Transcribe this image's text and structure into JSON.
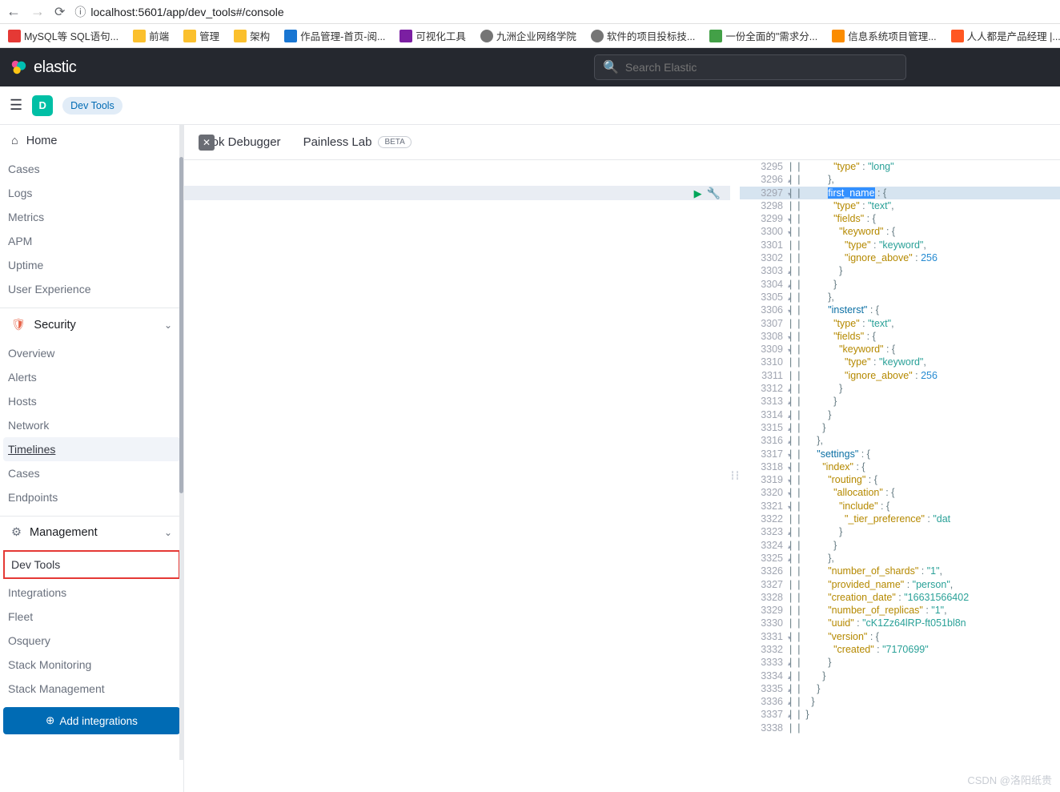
{
  "browser": {
    "url": "localhost:5601/app/dev_tools#/console"
  },
  "bookmarks": [
    {
      "icon": "red",
      "label": "MySQL等 SQL语句..."
    },
    {
      "icon": "yellow",
      "label": "前端"
    },
    {
      "icon": "yellow",
      "label": "管理"
    },
    {
      "icon": "yellow",
      "label": "架构"
    },
    {
      "icon": "blue",
      "label": "作品管理-首页-阅..."
    },
    {
      "icon": "purple",
      "label": "可视化工具"
    },
    {
      "icon": "gray",
      "label": "九洲企业网络学院"
    },
    {
      "icon": "gray",
      "label": "软件的项目投标技..."
    },
    {
      "icon": "green",
      "label": "一份全面的\"需求分..."
    },
    {
      "icon": "orange",
      "label": "信息系统项目管理..."
    },
    {
      "icon": "pink",
      "label": "人人都是产品经理 |..."
    }
  ],
  "header": {
    "brand": "elastic",
    "search_placeholder": "Search Elastic"
  },
  "subheader": {
    "avatar_letter": "D",
    "badge": "Dev Tools"
  },
  "tabs": {
    "grok": "Grok Debugger",
    "painless": "Painless Lab",
    "beta": "BETA"
  },
  "sidebar": {
    "home": "Home",
    "obs_items": [
      "Cases",
      "Logs",
      "Metrics",
      "APM",
      "Uptime",
      "User Experience"
    ],
    "security_label": "Security",
    "sec_items": [
      "Overview",
      "Alerts",
      "Hosts",
      "Network",
      "Timelines",
      "Cases",
      "Endpoints"
    ],
    "management_label": "Management",
    "mgmt_items": [
      "Dev Tools",
      "Integrations",
      "Fleet",
      "Osquery",
      "Stack Monitoring",
      "Stack Management"
    ],
    "add_integrations": "Add integrations"
  },
  "code_lines": [
    {
      "ln": "3295",
      "fold": "",
      "txt": [
        [
          "",
          "          "
        ],
        [
          "k",
          "\"type\""
        ],
        [
          "p",
          " : "
        ],
        [
          "s",
          "\"long\""
        ]
      ]
    },
    {
      "ln": "3296",
      "fold": "▴",
      "txt": [
        [
          "",
          "        "
        ],
        [
          "p",
          "},"
        ]
      ]
    },
    {
      "ln": "3297",
      "fold": "▾",
      "hl": true,
      "txt": [
        [
          "",
          "        "
        ],
        [
          "sel",
          "\"first_name\""
        ],
        [
          "p",
          " : {"
        ]
      ]
    },
    {
      "ln": "3298",
      "fold": "",
      "txt": [
        [
          "",
          "          "
        ],
        [
          "k",
          "\"type\""
        ],
        [
          "p",
          " : "
        ],
        [
          "s",
          "\"text\""
        ],
        [
          "p",
          ","
        ]
      ]
    },
    {
      "ln": "3299",
      "fold": "▾",
      "txt": [
        [
          "",
          "          "
        ],
        [
          "k",
          "\"fields\""
        ],
        [
          "p",
          " : {"
        ]
      ]
    },
    {
      "ln": "3300",
      "fold": "▾",
      "txt": [
        [
          "",
          "            "
        ],
        [
          "k",
          "\"keyword\""
        ],
        [
          "p",
          " : {"
        ]
      ]
    },
    {
      "ln": "3301",
      "fold": "",
      "txt": [
        [
          "",
          "              "
        ],
        [
          "k",
          "\"type\""
        ],
        [
          "p",
          " : "
        ],
        [
          "s",
          "\"keyword\""
        ],
        [
          "p",
          ","
        ]
      ]
    },
    {
      "ln": "3302",
      "fold": "",
      "txt": [
        [
          "",
          "              "
        ],
        [
          "k",
          "\"ignore_above\""
        ],
        [
          "p",
          " : "
        ],
        [
          "n",
          "256"
        ]
      ]
    },
    {
      "ln": "3303",
      "fold": "▴",
      "txt": [
        [
          "",
          "            "
        ],
        [
          "p",
          "}"
        ]
      ]
    },
    {
      "ln": "3304",
      "fold": "▴",
      "txt": [
        [
          "",
          "          "
        ],
        [
          "p",
          "}"
        ]
      ]
    },
    {
      "ln": "3305",
      "fold": "▴",
      "txt": [
        [
          "",
          "        "
        ],
        [
          "p",
          "},"
        ]
      ]
    },
    {
      "ln": "3306",
      "fold": "▾",
      "txt": [
        [
          "",
          "        "
        ],
        [
          "kb",
          "\"insterst\""
        ],
        [
          "p",
          " : {"
        ]
      ]
    },
    {
      "ln": "3307",
      "fold": "",
      "txt": [
        [
          "",
          "          "
        ],
        [
          "k",
          "\"type\""
        ],
        [
          "p",
          " : "
        ],
        [
          "s",
          "\"text\""
        ],
        [
          "p",
          ","
        ]
      ]
    },
    {
      "ln": "3308",
      "fold": "▾",
      "txt": [
        [
          "",
          "          "
        ],
        [
          "k",
          "\"fields\""
        ],
        [
          "p",
          " : {"
        ]
      ]
    },
    {
      "ln": "3309",
      "fold": "▾",
      "txt": [
        [
          "",
          "            "
        ],
        [
          "k",
          "\"keyword\""
        ],
        [
          "p",
          " : {"
        ]
      ]
    },
    {
      "ln": "3310",
      "fold": "",
      "txt": [
        [
          "",
          "              "
        ],
        [
          "k",
          "\"type\""
        ],
        [
          "p",
          " : "
        ],
        [
          "s",
          "\"keyword\""
        ],
        [
          "p",
          ","
        ]
      ]
    },
    {
      "ln": "3311",
      "fold": "",
      "txt": [
        [
          "",
          "              "
        ],
        [
          "k",
          "\"ignore_above\""
        ],
        [
          "p",
          " : "
        ],
        [
          "n",
          "256"
        ]
      ]
    },
    {
      "ln": "3312",
      "fold": "▴",
      "txt": [
        [
          "",
          "            "
        ],
        [
          "p",
          "}"
        ]
      ]
    },
    {
      "ln": "3313",
      "fold": "▴",
      "txt": [
        [
          "",
          "          "
        ],
        [
          "p",
          "}"
        ]
      ]
    },
    {
      "ln": "3314",
      "fold": "▴",
      "txt": [
        [
          "",
          "        "
        ],
        [
          "p",
          "}"
        ]
      ]
    },
    {
      "ln": "3315",
      "fold": "▴",
      "txt": [
        [
          "",
          "      "
        ],
        [
          "p",
          "}"
        ]
      ]
    },
    {
      "ln": "3316",
      "fold": "▴",
      "txt": [
        [
          "",
          "    "
        ],
        [
          "p",
          "},"
        ]
      ]
    },
    {
      "ln": "3317",
      "fold": "▾",
      "txt": [
        [
          "",
          "    "
        ],
        [
          "kb",
          "\"settings\""
        ],
        [
          "p",
          " : {"
        ]
      ]
    },
    {
      "ln": "3318",
      "fold": "▾",
      "txt": [
        [
          "",
          "      "
        ],
        [
          "k",
          "\"index\""
        ],
        [
          "p",
          " : {"
        ]
      ]
    },
    {
      "ln": "3319",
      "fold": "▾",
      "txt": [
        [
          "",
          "        "
        ],
        [
          "k",
          "\"routing\""
        ],
        [
          "p",
          " : {"
        ]
      ]
    },
    {
      "ln": "3320",
      "fold": "▾",
      "txt": [
        [
          "",
          "          "
        ],
        [
          "k",
          "\"allocation\""
        ],
        [
          "p",
          " : {"
        ]
      ]
    },
    {
      "ln": "3321",
      "fold": "▾",
      "txt": [
        [
          "",
          "            "
        ],
        [
          "k",
          "\"include\""
        ],
        [
          "p",
          " : {"
        ]
      ]
    },
    {
      "ln": "3322",
      "fold": "",
      "txt": [
        [
          "",
          "              "
        ],
        [
          "k",
          "\"_tier_preference\""
        ],
        [
          "p",
          " : "
        ],
        [
          "s",
          "\"dat"
        ]
      ]
    },
    {
      "ln": "3323",
      "fold": "▴",
      "txt": [
        [
          "",
          "            "
        ],
        [
          "p",
          "}"
        ]
      ]
    },
    {
      "ln": "3324",
      "fold": "▴",
      "txt": [
        [
          "",
          "          "
        ],
        [
          "p",
          "}"
        ]
      ]
    },
    {
      "ln": "3325",
      "fold": "▴",
      "txt": [
        [
          "",
          "        "
        ],
        [
          "p",
          "},"
        ]
      ]
    },
    {
      "ln": "3326",
      "fold": "",
      "txt": [
        [
          "",
          "        "
        ],
        [
          "k",
          "\"number_of_shards\""
        ],
        [
          "p",
          " : "
        ],
        [
          "s",
          "\"1\""
        ],
        [
          "p",
          ","
        ]
      ]
    },
    {
      "ln": "3327",
      "fold": "",
      "txt": [
        [
          "",
          "        "
        ],
        [
          "k",
          "\"provided_name\""
        ],
        [
          "p",
          " : "
        ],
        [
          "s",
          "\"person\""
        ],
        [
          "p",
          ","
        ]
      ]
    },
    {
      "ln": "3328",
      "fold": "",
      "txt": [
        [
          "",
          "        "
        ],
        [
          "k",
          "\"creation_date\""
        ],
        [
          "p",
          " : "
        ],
        [
          "s",
          "\"16631566402"
        ]
      ]
    },
    {
      "ln": "3329",
      "fold": "",
      "txt": [
        [
          "",
          "        "
        ],
        [
          "k",
          "\"number_of_replicas\""
        ],
        [
          "p",
          " : "
        ],
        [
          "s",
          "\"1\""
        ],
        [
          "p",
          ","
        ]
      ]
    },
    {
      "ln": "3330",
      "fold": "",
      "txt": [
        [
          "",
          "        "
        ],
        [
          "k",
          "\"uuid\""
        ],
        [
          "p",
          " : "
        ],
        [
          "s",
          "\"cK1Zz64lRP-ft051bl8n"
        ]
      ]
    },
    {
      "ln": "3331",
      "fold": "▾",
      "txt": [
        [
          "",
          "        "
        ],
        [
          "k",
          "\"version\""
        ],
        [
          "p",
          " : {"
        ]
      ]
    },
    {
      "ln": "3332",
      "fold": "",
      "txt": [
        [
          "",
          "          "
        ],
        [
          "k",
          "\"created\""
        ],
        [
          "p",
          " : "
        ],
        [
          "s",
          "\"7170699\""
        ]
      ]
    },
    {
      "ln": "3333",
      "fold": "▴",
      "txt": [
        [
          "",
          "        "
        ],
        [
          "p",
          "}"
        ]
      ]
    },
    {
      "ln": "3334",
      "fold": "▴",
      "txt": [
        [
          "",
          "      "
        ],
        [
          "p",
          "}"
        ]
      ]
    },
    {
      "ln": "3335",
      "fold": "▴",
      "txt": [
        [
          "",
          "    "
        ],
        [
          "p",
          "}"
        ]
      ]
    },
    {
      "ln": "3336",
      "fold": "▴",
      "txt": [
        [
          "",
          "  "
        ],
        [
          "p",
          "}"
        ]
      ]
    },
    {
      "ln": "3337",
      "fold": "▴",
      "txt": [
        [
          "p",
          "}"
        ]
      ]
    },
    {
      "ln": "3338",
      "fold": "",
      "txt": [
        [
          "",
          ""
        ]
      ]
    }
  ],
  "watermark": "CSDN @洛阳纸贵"
}
